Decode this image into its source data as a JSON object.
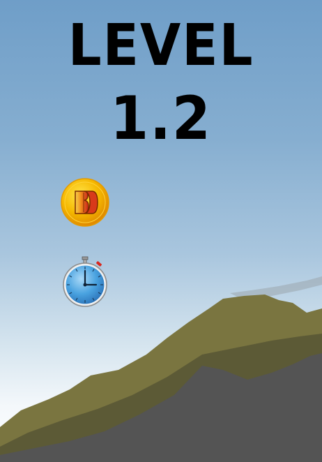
{
  "level": {
    "word": "LEVEL",
    "number": "1.2"
  },
  "icons": {
    "coin": "coin-icon",
    "stopwatch": "stopwatch-icon"
  },
  "colors": {
    "sky_top": "#6f9ec8",
    "sky_bottom": "#ffffff",
    "hill_front": "#7a7540",
    "hill_back": "#5c5a36",
    "ground": "#545454",
    "title": "#000000",
    "coin_gold": "#f5b800",
    "coin_red": "#d9261c",
    "watch_face": "#4aa3e0"
  }
}
